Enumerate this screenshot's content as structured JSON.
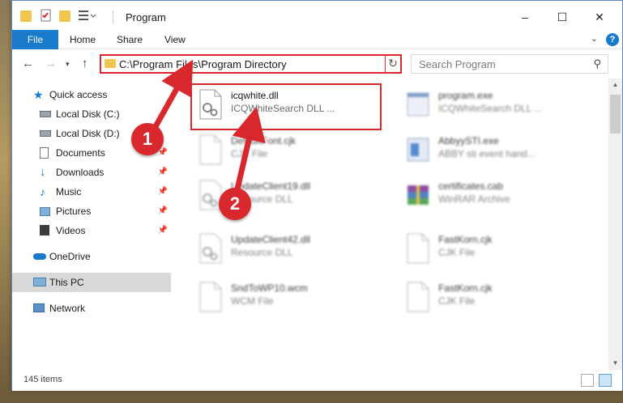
{
  "window": {
    "title": "Program",
    "buttons": {
      "minimize": "–",
      "maximize": "☐",
      "close": "✕"
    }
  },
  "ribbon": {
    "tabs": [
      "File",
      "Home",
      "Share",
      "View"
    ]
  },
  "nav": {
    "address": "C:\\Program Files\\Program Directory",
    "search_placeholder": "Search Program"
  },
  "sidebar": {
    "items": [
      {
        "label": "Quick access",
        "icon": "star-icon"
      },
      {
        "label": "Local Disk (C:)",
        "icon": "drive-icon"
      },
      {
        "label": "Local Disk (D:)",
        "icon": "drive-icon"
      },
      {
        "label": "Documents",
        "icon": "documents-icon",
        "pinned": true
      },
      {
        "label": "Downloads",
        "icon": "download-icon",
        "pinned": true
      },
      {
        "label": "Music",
        "icon": "music-icon",
        "pinned": true
      },
      {
        "label": "Pictures",
        "icon": "pictures-icon",
        "pinned": true
      },
      {
        "label": "Videos",
        "icon": "videos-icon",
        "pinned": true
      },
      {
        "label": "OneDrive",
        "icon": "cloud-icon"
      },
      {
        "label": "This PC",
        "icon": "computer-icon",
        "selected": true
      },
      {
        "label": "Network",
        "icon": "network-icon"
      }
    ]
  },
  "files": [
    {
      "name": "icqwhite.dll",
      "desc": "ICQWhiteSearch DLL ...",
      "col": 0,
      "row": 0,
      "icon": "dll-icon"
    },
    {
      "name": "program.exe",
      "desc": "ICQWhiteSearch DLL ...",
      "col": 1,
      "row": 0,
      "icon": "exe-icon"
    },
    {
      "name": "DefaultFont.cjk",
      "desc": "CJK File",
      "col": 0,
      "row": 1,
      "icon": "file-icon"
    },
    {
      "name": "AbbyySTI.exe",
      "desc": "ABBY sti event hand...",
      "col": 1,
      "row": 1,
      "icon": "exe-icon"
    },
    {
      "name": "UpdateClient19.dll",
      "desc": "Resource DLL",
      "col": 0,
      "row": 2,
      "icon": "dll-icon"
    },
    {
      "name": "certificates.cab",
      "desc": "WinRAR Archive",
      "col": 1,
      "row": 2,
      "icon": "archive-icon"
    },
    {
      "name": "UpdateClient42.dll",
      "desc": "Resource DLL",
      "col": 0,
      "row": 3,
      "icon": "dll-icon"
    },
    {
      "name": "FastKorn.cjk",
      "desc": "CJK File",
      "col": 1,
      "row": 3,
      "icon": "file-icon"
    },
    {
      "name": "SndToWP10.wcm",
      "desc": "WCM File",
      "col": 0,
      "row": 4,
      "icon": "file-icon"
    },
    {
      "name": "FastKorn.cjk",
      "desc": "CJK File",
      "col": 1,
      "row": 4,
      "icon": "file-icon"
    }
  ],
  "status": {
    "items": "145 items"
  },
  "annotations": {
    "step1": "1",
    "step2": "2"
  },
  "colors": {
    "accent": "#1979ca",
    "highlight": "#d9272e",
    "folder": "#f0c550"
  }
}
